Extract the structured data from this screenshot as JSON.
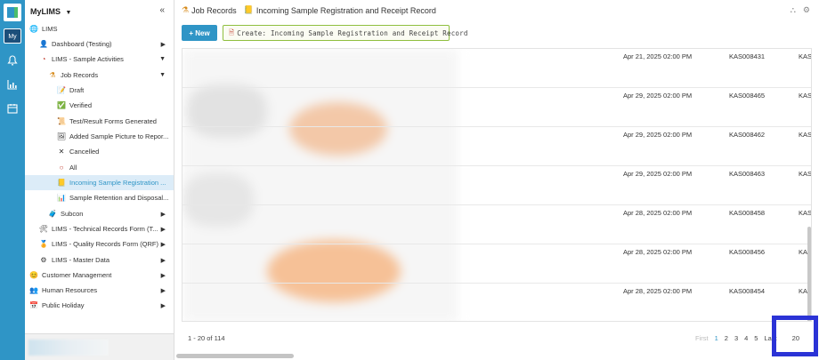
{
  "rail": {
    "my_label": "My"
  },
  "sidebar": {
    "title": "MyLIMS",
    "items": [
      {
        "label": "LIMS",
        "icon": "globe-icon",
        "glyph": "🌐"
      },
      {
        "label": "Dashboard (Testing)",
        "icon": "person-icon",
        "glyph": "👤"
      },
      {
        "label": "LIMS - Sample Activities",
        "icon": "pie-icon",
        "glyph": "◔"
      },
      {
        "label": "Job Records",
        "icon": "flask-icon",
        "glyph": "⚗"
      },
      {
        "label": "Draft",
        "icon": "draft-icon",
        "glyph": "📝"
      },
      {
        "label": "Verified",
        "icon": "check-icon",
        "glyph": "✅"
      },
      {
        "label": "Test/Result Forms Generated",
        "icon": "form-icon",
        "glyph": "📜"
      },
      {
        "label": "Added Sample Picture to Repor...",
        "icon": "picture-icon",
        "glyph": "🖼"
      },
      {
        "label": "Cancelled",
        "icon": "close-icon",
        "glyph": "✕"
      },
      {
        "label": "All",
        "icon": "circle-icon",
        "glyph": "○"
      },
      {
        "label": "Incoming Sample Registration ...",
        "icon": "folder-icon",
        "glyph": "📒"
      },
      {
        "label": "Sample Retention and Disposal...",
        "icon": "chart-icon",
        "glyph": "📊"
      },
      {
        "label": "Subcon",
        "icon": "subcon-icon",
        "glyph": "🧳"
      },
      {
        "label": "LIMS - Technical Records Form (T...",
        "icon": "tools-icon",
        "glyph": "🛠"
      },
      {
        "label": "LIMS - Quality Records Form (QRF)",
        "icon": "award-icon",
        "glyph": "🏅"
      },
      {
        "label": "LIMS - Master Data",
        "icon": "gear-icon",
        "glyph": "⚙"
      },
      {
        "label": "Customer Management",
        "icon": "smile-icon",
        "glyph": "😊"
      },
      {
        "label": "Human Resources",
        "icon": "people-icon",
        "glyph": "👥"
      },
      {
        "label": "Public Holiday",
        "icon": "calendar-icon",
        "glyph": "📅"
      }
    ]
  },
  "breadcrumb": {
    "parent": "Job Records",
    "current": "Incoming Sample Registration and Receipt Record"
  },
  "toolbar": {
    "new_label": "+ New",
    "create_label": "Create: Incoming Sample Registration and Receipt Record"
  },
  "rows": [
    {
      "date": "Apr 21, 2025 02:00 PM",
      "code": "KAS008431",
      "extra": "KAS"
    },
    {
      "date": "Apr 29, 2025 02:00 PM",
      "code": "KAS008465",
      "extra": "KAS"
    },
    {
      "date": "Apr 29, 2025 02:00 PM",
      "code": "KAS008462",
      "extra": "KAS"
    },
    {
      "date": "Apr 29, 2025 02:00 PM",
      "code": "KAS008463",
      "extra": "KAS"
    },
    {
      "date": "Apr 28, 2025 02:00 PM",
      "code": "KAS008458",
      "extra": "KAS"
    },
    {
      "date": "Apr 28, 2025 02:00 PM",
      "code": "KAS008456",
      "extra": "KAS"
    },
    {
      "date": "Apr 28, 2025 02:00 PM",
      "code": "KAS008454",
      "extra": "KAS"
    }
  ],
  "pager": {
    "info": "1 - 20 of 114",
    "first": "First",
    "pages": [
      "1",
      "2",
      "3",
      "4",
      "5"
    ],
    "last": "Last",
    "page_size": "20"
  },
  "colors": {
    "accent": "#2f95c6",
    "highlight": "#2b33d6"
  }
}
